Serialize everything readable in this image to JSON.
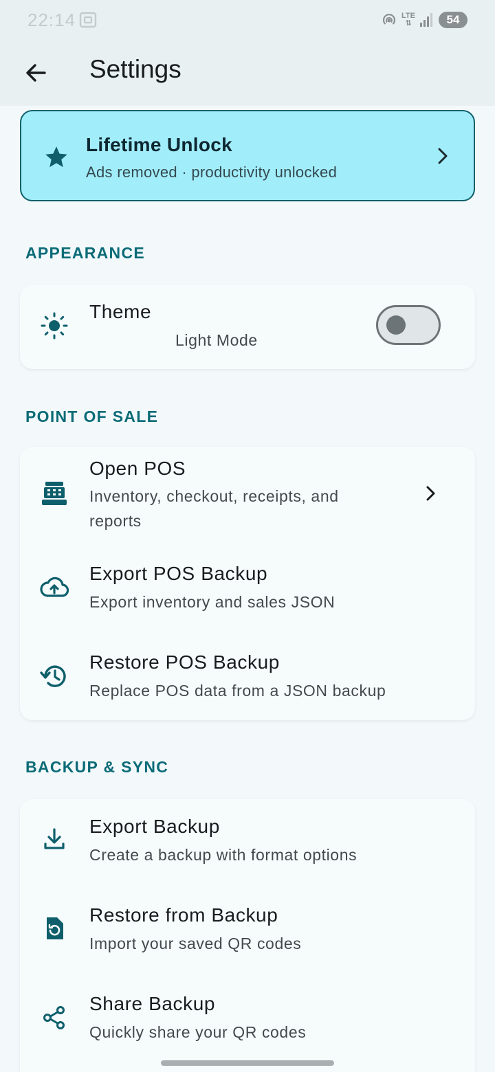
{
  "status_bar": {
    "time": "22:14",
    "network": "LTE",
    "battery": "54"
  },
  "app_bar": {
    "title": "Settings"
  },
  "promo": {
    "title": "Lifetime Unlock",
    "subtitle": "Ads removed · productivity unlocked"
  },
  "sections": {
    "appearance": {
      "header": "APPEARANCE",
      "theme": {
        "title": "Theme",
        "value": "Light Mode",
        "dark_mode_enabled": false
      }
    },
    "pos": {
      "header": "POINT OF SALE",
      "open_pos": {
        "title": "Open POS",
        "subtitle": "Inventory, checkout, receipts, and reports"
      },
      "export_pos": {
        "title": "Export POS Backup",
        "subtitle": "Export inventory and sales JSON"
      },
      "restore_pos": {
        "title": "Restore POS Backup",
        "subtitle": "Replace POS data from a JSON backup"
      }
    },
    "backup": {
      "header": "BACKUP & SYNC",
      "export": {
        "title": "Export Backup",
        "subtitle": "Create a backup with format options"
      },
      "restore": {
        "title": "Restore from Backup",
        "subtitle": "Import your saved QR codes"
      },
      "share": {
        "title": "Share Backup",
        "subtitle": "Quickly share your QR codes"
      }
    }
  },
  "icons": {
    "back": "arrow-left-icon",
    "promo": "star-icon",
    "theme": "sun-icon",
    "open_pos": "cash-register-icon",
    "export_pos": "cloud-upload-icon",
    "restore_pos": "history-icon",
    "export": "download-icon",
    "restore": "file-restore-icon",
    "share": "share-icon"
  },
  "colors": {
    "accent": "#0b6b77",
    "promo_bg": "#a2edfa",
    "background": "#f3f9fb"
  }
}
